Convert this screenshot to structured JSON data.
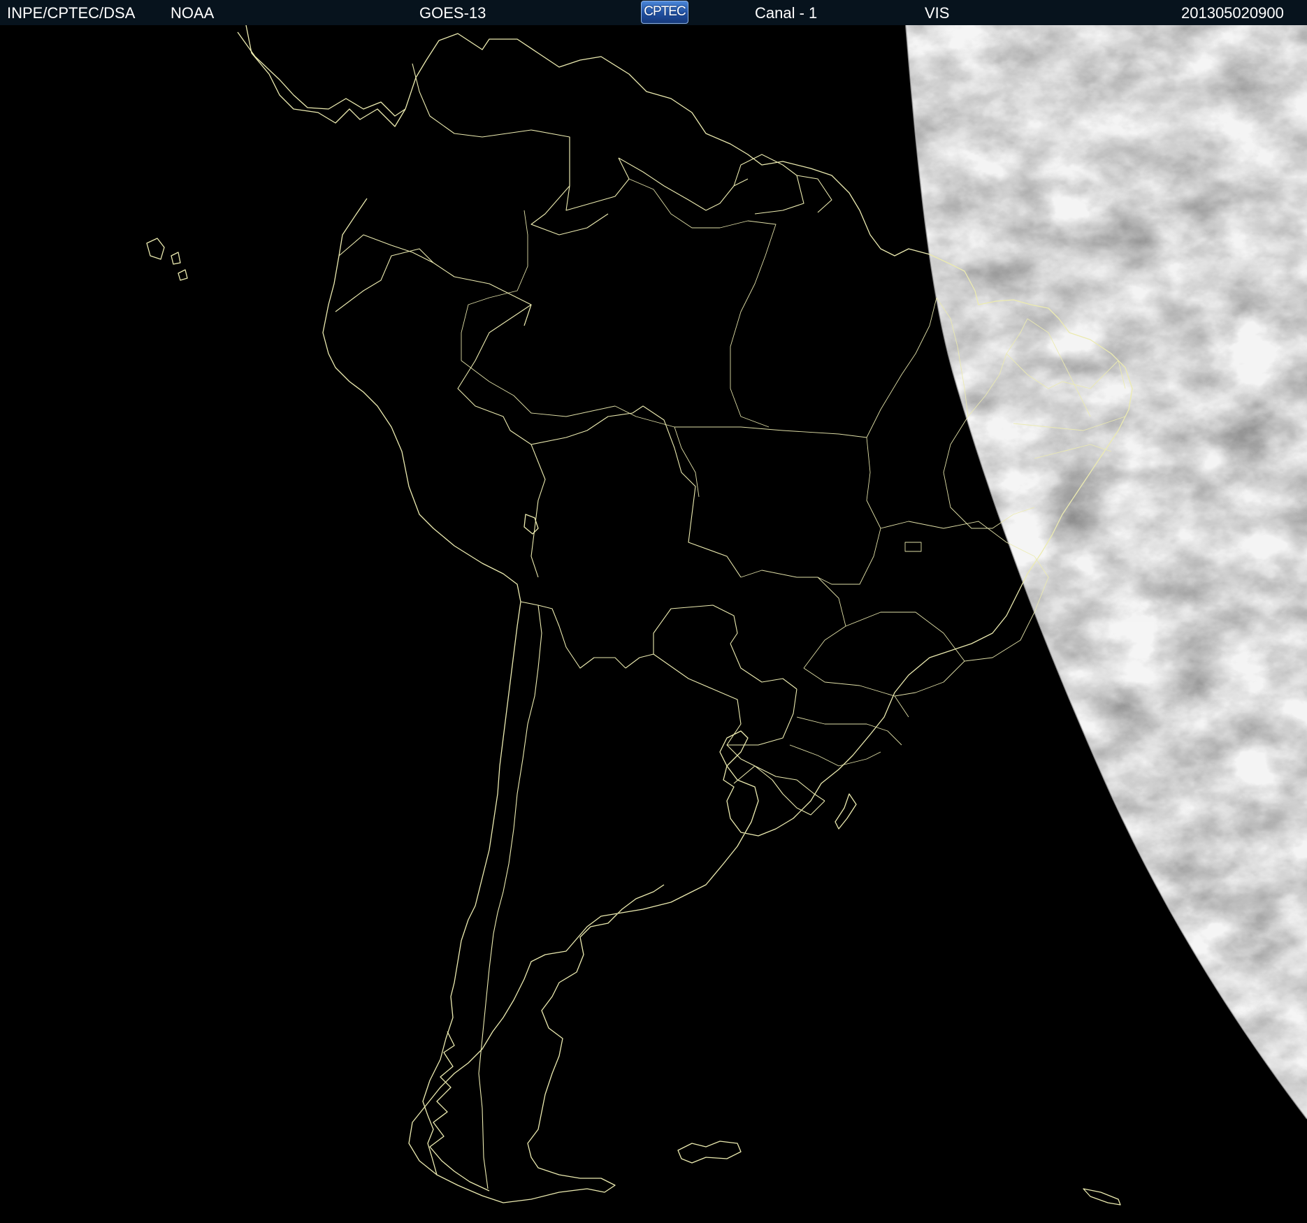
{
  "header": {
    "source": "INPE/CPTEC/DSA",
    "agency": "NOAA",
    "satellite": "GOES-13",
    "logo_text": "CPTEC",
    "channel": "Canal - 1",
    "band": "VIS",
    "timestamp": "201305020900"
  },
  "colors": {
    "header_bg": "#07131d",
    "header_text": "#ffffff",
    "background": "#000000",
    "coastline": "#ecebb0",
    "cloud_light": "#e8e8e8",
    "cloud_dark": "#5a5a5a"
  },
  "map": {
    "projection": "satellite VIS image, South America",
    "layers": [
      "coastlines",
      "country-borders",
      "brazil-state-borders",
      "lit-earth-limb"
    ]
  }
}
